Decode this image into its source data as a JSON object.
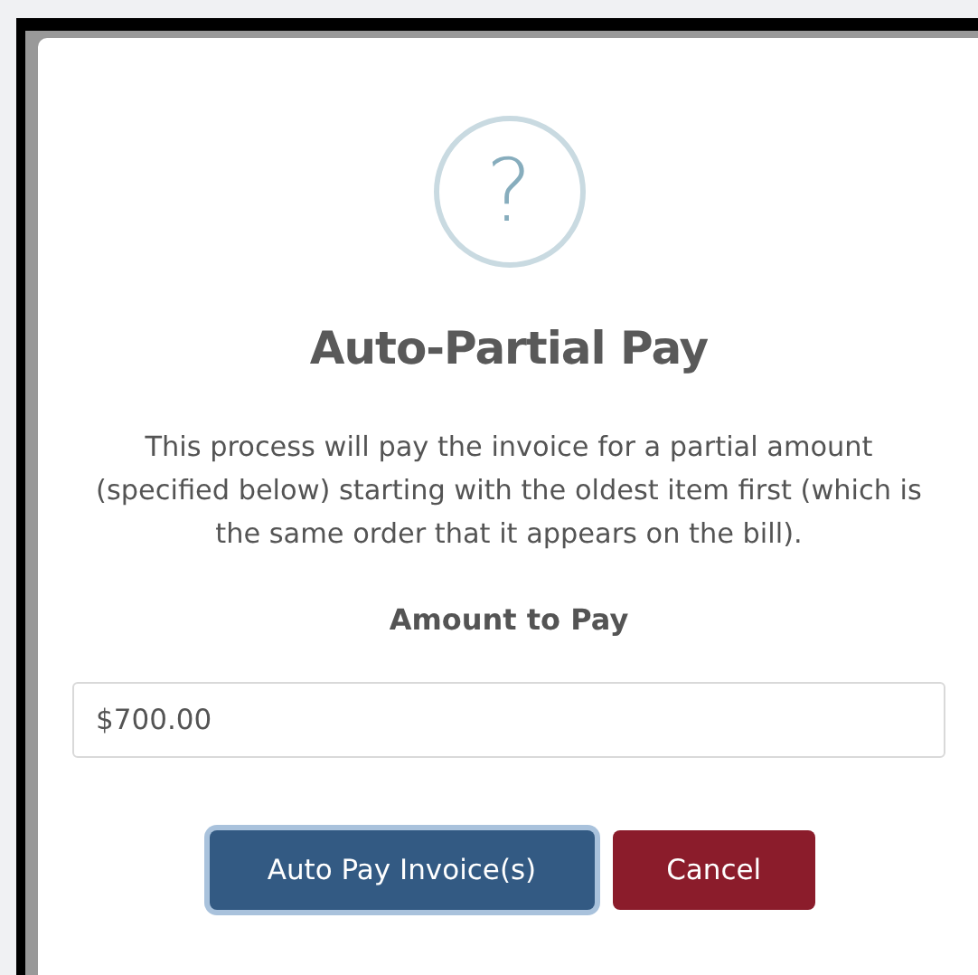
{
  "dialog": {
    "icon": "?",
    "title": "Auto-Partial Pay",
    "message": "This process will pay the invoice for a partial amount (specified below) starting with the oldest item first (which is the same order that it appears on the bill).",
    "amount_field": {
      "label": "Amount to Pay",
      "value": "$700.00"
    },
    "buttons": [
      {
        "label": "Auto Pay Invoice(s)",
        "kind": "primary"
      },
      {
        "label": "Cancel",
        "kind": "danger"
      }
    ]
  }
}
